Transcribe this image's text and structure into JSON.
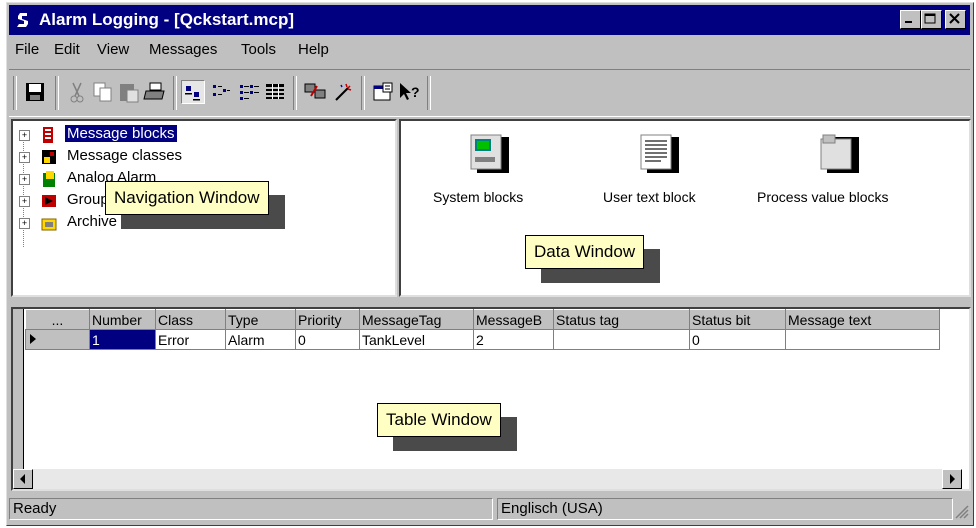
{
  "window": {
    "title": "Alarm Logging - [Qckstart.mcp]"
  },
  "menubar": {
    "items": [
      {
        "label": "File"
      },
      {
        "label": "Edit"
      },
      {
        "label": "View"
      },
      {
        "label": "Messages"
      },
      {
        "label": "Tools"
      },
      {
        "label": "Help"
      }
    ]
  },
  "toolbar": {
    "buttons": [
      "save-icon",
      "cut-icon",
      "copy-icon",
      "paste-icon",
      "print-icon",
      "large-icons-icon",
      "small-icons-icon",
      "list-icon",
      "details-icon",
      "import-icon",
      "wizard-icon",
      "properties-icon",
      "help-icon"
    ]
  },
  "navigation": {
    "items": [
      {
        "label": "Message blocks",
        "selected": true
      },
      {
        "label": "Message classes"
      },
      {
        "label": "Analog Alarm"
      },
      {
        "label": "Group messages"
      },
      {
        "label": "Archive Configuration"
      }
    ],
    "callout": "Navigation Window"
  },
  "data_window": {
    "items": [
      {
        "label": "System blocks"
      },
      {
        "label": "User text block"
      },
      {
        "label": "Process value blocks"
      }
    ],
    "callout": "Data Window"
  },
  "table": {
    "headers": [
      "...",
      "Number",
      "Class",
      "Type",
      "Priority",
      "MessageTag",
      "MessageB",
      "Status tag",
      "Status bit",
      "Message text"
    ],
    "rows": [
      [
        "",
        "1",
        "Error",
        "Alarm",
        "0",
        "TankLevel",
        "2",
        "",
        "0",
        ""
      ]
    ],
    "callout": "Table Window"
  },
  "statusbar": {
    "left": "Ready",
    "middle": "Englisch (USA)"
  }
}
